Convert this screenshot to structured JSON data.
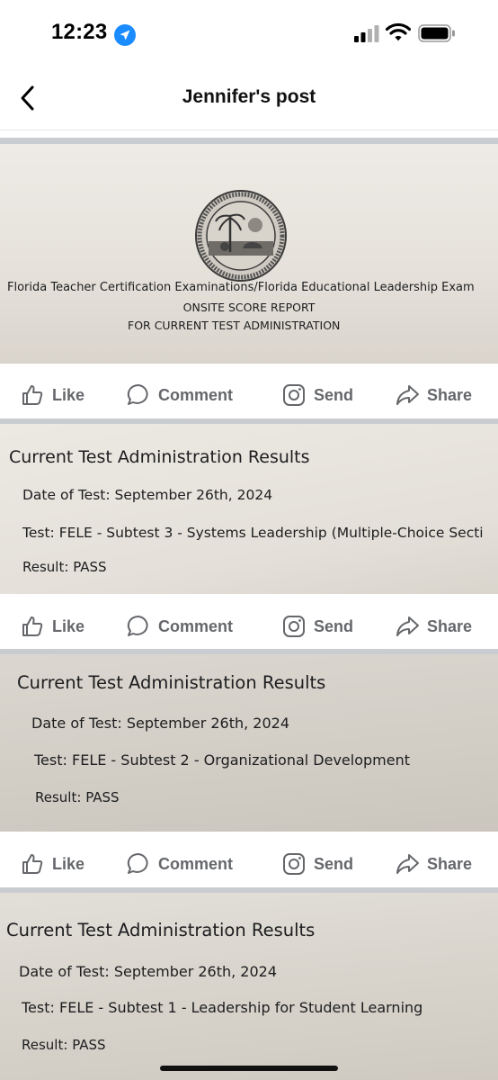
{
  "status_bar": {
    "time": "12:23"
  },
  "nav": {
    "title": "Jennifer's post"
  },
  "post_images": [
    {
      "header_line1": "Florida Teacher Certification Examinations/Florida Educational Leadership Exam",
      "header_line2": "ONSITE SCORE REPORT",
      "header_line3": "FOR CURRENT TEST ADMINISTRATION"
    },
    {
      "heading": "Current Test Administration Results",
      "date_label": "Date of Test:",
      "date_value": "September 26th, 2024",
      "test_label": "Test:",
      "test_value": "FELE - Subtest 3 - Systems Leadership (Multiple-Choice Secti",
      "result_label": "Result:",
      "result_value": "PASS"
    },
    {
      "heading": "Current Test Administration Results",
      "date_label": "Date of Test:",
      "date_value": "September 26th, 2024",
      "test_label": "Test:",
      "test_value": "FELE - Subtest 2 - Organizational Development",
      "result_label": "Result:",
      "result_value": "PASS"
    },
    {
      "heading": "Current Test Administration Results",
      "date_label": "Date of Test:",
      "date_value": "September 26th, 2024",
      "test_label": "Test:",
      "test_value": "FELE - Subtest 1 - Leadership for Student Learning",
      "result_label": "Result:",
      "result_value": "PASS"
    }
  ],
  "actions": {
    "like": "Like",
    "comment": "Comment",
    "send": "Send",
    "share": "Share"
  },
  "colors": {
    "action_gray": "#65676b",
    "separator": "#c9ccd1",
    "location_blue": "#1a8cff"
  },
  "icons": [
    "location-arrow-icon",
    "signal-icon",
    "wifi-icon",
    "battery-icon",
    "back-chevron-icon",
    "thumbs-up-icon",
    "comment-bubble-icon",
    "instagram-send-icon",
    "share-arrow-icon",
    "state-seal-icon"
  ]
}
